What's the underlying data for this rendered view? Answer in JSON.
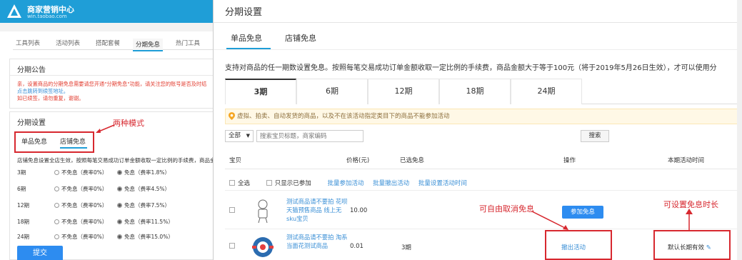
{
  "colors": {
    "accent": "#1f9ed7",
    "annotation": "#d7282f",
    "primary_button": "#2d8cf0",
    "link": "#3a8fd6"
  },
  "left": {
    "brand": {
      "title": "商家营销中心",
      "subtitle": "win.taobao.com"
    },
    "tabs": [
      "工具列表",
      "活动列表",
      "搭配套餐",
      "分期免息",
      "热门工具"
    ],
    "announcement": {
      "heading": "分期公告",
      "lines": [
        "亲，设置商品的分期免息需要请您开通\"分期免息\"功能，请关注您的账号是否及时结",
        "点击跳转到续签地址。",
        "如已续签，请勿重复，谢谢。"
      ]
    },
    "settings": {
      "heading": "分期设置",
      "mode_tabs": [
        "单品免息",
        "店铺免息"
      ],
      "mode_note": "两种模式",
      "banner": "店铺免息设置全店生效，按照每笔交易成功订单金额收取一定比例的手续费，商品金额",
      "rows": [
        {
          "period": "3期",
          "opt1": "不免息（费率0%）",
          "opt2": "免息（费率1.8%）"
        },
        {
          "period": "6期",
          "opt1": "不免息（费率0%）",
          "opt2": "免息（费率4.5%）"
        },
        {
          "period": "12期",
          "opt1": "不免息（费率0%）",
          "opt2": "免息（费率7.5%）"
        },
        {
          "period": "18期",
          "opt1": "不免息（费率0%）",
          "opt2": "免息（费率11.5%）"
        },
        {
          "period": "24期",
          "opt1": "不免息（费率0%）",
          "opt2": "免息（费率15.0%）"
        }
      ],
      "submit": "提交"
    }
  },
  "right": {
    "title": "分期设置",
    "tabs": [
      "单品免息",
      "店铺免息"
    ],
    "description": "支持对商品的任一期数设置免息。按照每笔交易成功订单金额收取一定比例的手续费，商品金额大于等于100元（将于2019年5月26日生效），才可以使用分",
    "period_tabs": [
      "3期",
      "6期",
      "12期",
      "18期",
      "24期"
    ],
    "warning": "虚拟、拍卖、自动发货的商品，以及不在该活动指定类目下的商品不能参加活动",
    "filter": {
      "select": "全部",
      "placeholder": "搜索宝贝标题，商家编码",
      "search": "搜索"
    },
    "columns": [
      "宝贝",
      "价格(元)",
      "已选免息",
      "操作",
      "本期活动时间"
    ],
    "bulk": {
      "select_all": "全选",
      "only_joined": "只显示已参加",
      "batch_join": "批量参加活动",
      "batch_quit": "批量撤出活动",
      "batch_time": "批量设置活动时间"
    },
    "products": [
      {
        "name": "测试商品请不要拍 花呗天猫预售商品 线上无sku宝贝",
        "price": "10.00",
        "selected": "",
        "action": "参加免息"
      },
      {
        "name": "测试商品请不要拍 淘系当面花测试商品",
        "price": "0.01",
        "selected": "3期",
        "action": "撤出活动",
        "duration": "默认长期有效"
      }
    ],
    "notes": {
      "cancel": "可自由取消免息",
      "duration": "可设置免息时长"
    }
  }
}
